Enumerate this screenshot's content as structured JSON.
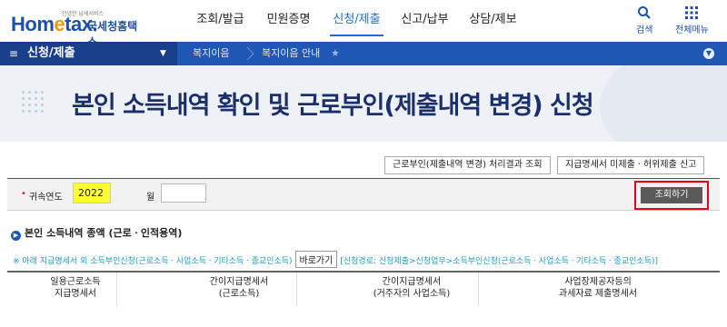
{
  "header": {
    "logo_sub": "안녕한 납세서비스",
    "logo_main_prefix": "Hom",
    "logo_main_e": "e",
    "logo_main_suffix": "tax.",
    "logo_kr": "국세청홈택스",
    "nav": [
      "조회/발급",
      "민원증명",
      "신청/제출",
      "신고/납부",
      "상담/제보"
    ],
    "active_nav": "신청/제출",
    "search_label": "검색",
    "allmenu_label": "전체메뉴"
  },
  "location": {
    "title": "신청/제출",
    "crumbs": [
      "복지이음",
      "복지이음 안내"
    ]
  },
  "banner": {
    "title": "본인 소득내역 확인 및 근로부인(제출내역 변경) 신청"
  },
  "actions": {
    "result_button": "근로부인(제출내역 변경) 처리결과 조회",
    "report_button": "지급명세서 미제출ㆍ허위제출 신고"
  },
  "search": {
    "required_mark": "•",
    "year_label": "귀속연도",
    "year_value": "2022",
    "month_label": "월",
    "month_value": "",
    "search_button": "조회하기"
  },
  "section": {
    "heading": "본인 소득내역 종액  (근로ㆍ인적용역)",
    "notice_prefix": "※ 아래 지급명세서 외 소득부인신청(근로소득ㆍ사업소득ㆍ기타소득ㆍ종교인소득)",
    "notice_button": "바로가기",
    "notice_suffix": "[신청경로: 신청제출>신청업무>소득부인신청(근로소득ㆍ사업소득ㆍ기타소득ㆍ종교인소득)]"
  },
  "table": {
    "headers": [
      [
        "일용근로소득",
        "지급명세서"
      ],
      [
        "간이지급명세서",
        "(근로소득)"
      ],
      [
        "간이지급명세서",
        "(거주자의 사업소득)"
      ],
      [
        "사업장제공자등의",
        "과세자료 제출명세서"
      ]
    ]
  },
  "colors": {
    "brand_blue": "#1f57b4",
    "dark_blue": "#1a3f8a",
    "highlight_yellow": "#ffff33",
    "annotation_red": "#e6001a"
  }
}
